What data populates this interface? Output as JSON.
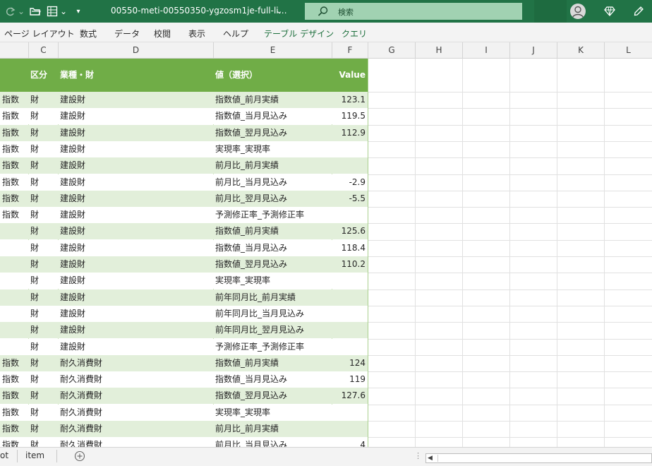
{
  "window": {
    "title": "00550-meti-00550350-ygzosm1je-full-li…",
    "search_placeholder": "検索"
  },
  "menu": {
    "items": [
      "ページ レイアウト",
      "数式",
      "データ",
      "校閲",
      "表示",
      "ヘルプ"
    ],
    "context_items": [
      "テーブル デザイン",
      "クエリ"
    ]
  },
  "columns": [
    "C",
    "D",
    "E",
    "F",
    "G",
    "H",
    "I",
    "J",
    "K",
    "L"
  ],
  "table": {
    "headers": [
      "区分",
      "業種・財",
      "値（選択）",
      "Value"
    ],
    "rows": [
      [
        "指数",
        "財",
        "建設財",
        "指数値_前月実績",
        "123.1"
      ],
      [
        "指数",
        "財",
        "建設財",
        "指数値_当月見込み",
        "119.5"
      ],
      [
        "指数",
        "財",
        "建設財",
        "指数値_翌月見込み",
        "112.9"
      ],
      [
        "指数",
        "財",
        "建設財",
        "実現率_実現率",
        ""
      ],
      [
        "指数",
        "財",
        "建設財",
        "前月比_前月実績",
        ""
      ],
      [
        "指数",
        "財",
        "建設財",
        "前月比_当月見込み",
        "-2.9"
      ],
      [
        "指数",
        "財",
        "建設財",
        "前月比_翌月見込み",
        "-5.5"
      ],
      [
        "指数",
        "財",
        "建設財",
        "予測修正率_予測修正率",
        ""
      ],
      [
        "",
        "財",
        "建設財",
        "指数値_前月実績",
        "125.6"
      ],
      [
        "",
        "財",
        "建設財",
        "指数値_当月見込み",
        "118.4"
      ],
      [
        "",
        "財",
        "建設財",
        "指数値_翌月見込み",
        "110.2"
      ],
      [
        "",
        "財",
        "建設財",
        "実現率_実現率",
        ""
      ],
      [
        "",
        "財",
        "建設財",
        "前年同月比_前月実績",
        ""
      ],
      [
        "",
        "財",
        "建設財",
        "前年同月比_当月見込み",
        ""
      ],
      [
        "",
        "財",
        "建設財",
        "前年同月比_翌月見込み",
        ""
      ],
      [
        "",
        "財",
        "建設財",
        "予測修正率_予測修正率",
        ""
      ],
      [
        "指数",
        "財",
        "耐久消費財",
        "指数値_前月実績",
        "124"
      ],
      [
        "指数",
        "財",
        "耐久消費財",
        "指数値_当月見込み",
        "119"
      ],
      [
        "指数",
        "財",
        "耐久消費財",
        "指数値_翌月見込み",
        "127.6"
      ],
      [
        "指数",
        "財",
        "耐久消費財",
        "実現率_実現率",
        ""
      ],
      [
        "指数",
        "財",
        "耐久消費財",
        "前月比_前月実績",
        ""
      ],
      [
        "指数",
        "財",
        "耐久消費財",
        "前月比_当月見込み",
        "4"
      ]
    ]
  },
  "sheets": [
    "ot",
    "item"
  ],
  "colors": {
    "title_bar": "#217346",
    "table_header": "#70ad47",
    "band_light": "#e2efda",
    "context_tab_text": "#1b6e3b"
  },
  "icons": [
    "redo-icon",
    "open-folder-icon",
    "form-icon",
    "customize-toolbar-icon",
    "search-icon",
    "user-avatar-icon",
    "diamond-icon",
    "pen-icon",
    "add-sheet-icon"
  ]
}
